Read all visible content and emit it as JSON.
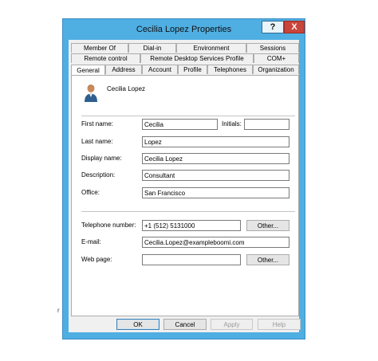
{
  "window": {
    "title": "Cecilia Lopez Properties",
    "help_glyph": "?",
    "close_glyph": "X"
  },
  "tabs": {
    "row1": [
      "Member Of",
      "Dial-in",
      "Environment",
      "Sessions"
    ],
    "row2": [
      "Remote control",
      "Remote Desktop Services Profile",
      "COM+"
    ],
    "row3": [
      "General",
      "Address",
      "Account",
      "Profile",
      "Telephones",
      "Organization"
    ],
    "active": "General"
  },
  "general": {
    "display_heading": "Cecilia Lopez",
    "first_name": {
      "label": "First name:",
      "value": "Cecilia"
    },
    "initials": {
      "label": "Initials:",
      "value": ""
    },
    "last_name": {
      "label": "Last name:",
      "value": "Lopez"
    },
    "display_name": {
      "label": "Display name:",
      "value": "Cecilia Lopez"
    },
    "description": {
      "label": "Description:",
      "value": "Consultant"
    },
    "office": {
      "label": "Office:",
      "value": "San Francisco"
    },
    "telephone": {
      "label": "Telephone number:",
      "value": "+1 (512) 5131000",
      "other_label": "Other..."
    },
    "email": {
      "label": "E-mail:",
      "value": "Cecilia.Lopez@exampleboomi.com"
    },
    "web_page": {
      "label": "Web page:",
      "value": "",
      "other_label": "Other..."
    }
  },
  "footer": {
    "ok": "OK",
    "cancel": "Cancel",
    "apply": "Apply",
    "help": "Help"
  },
  "colors": {
    "frame": "#4faee2",
    "close": "#c9443a",
    "dialog": "#f0f0f0",
    "panel": "#ffffff"
  },
  "icons": [
    "help-icon",
    "close-icon",
    "user-icon"
  ],
  "stray_mark": "r"
}
